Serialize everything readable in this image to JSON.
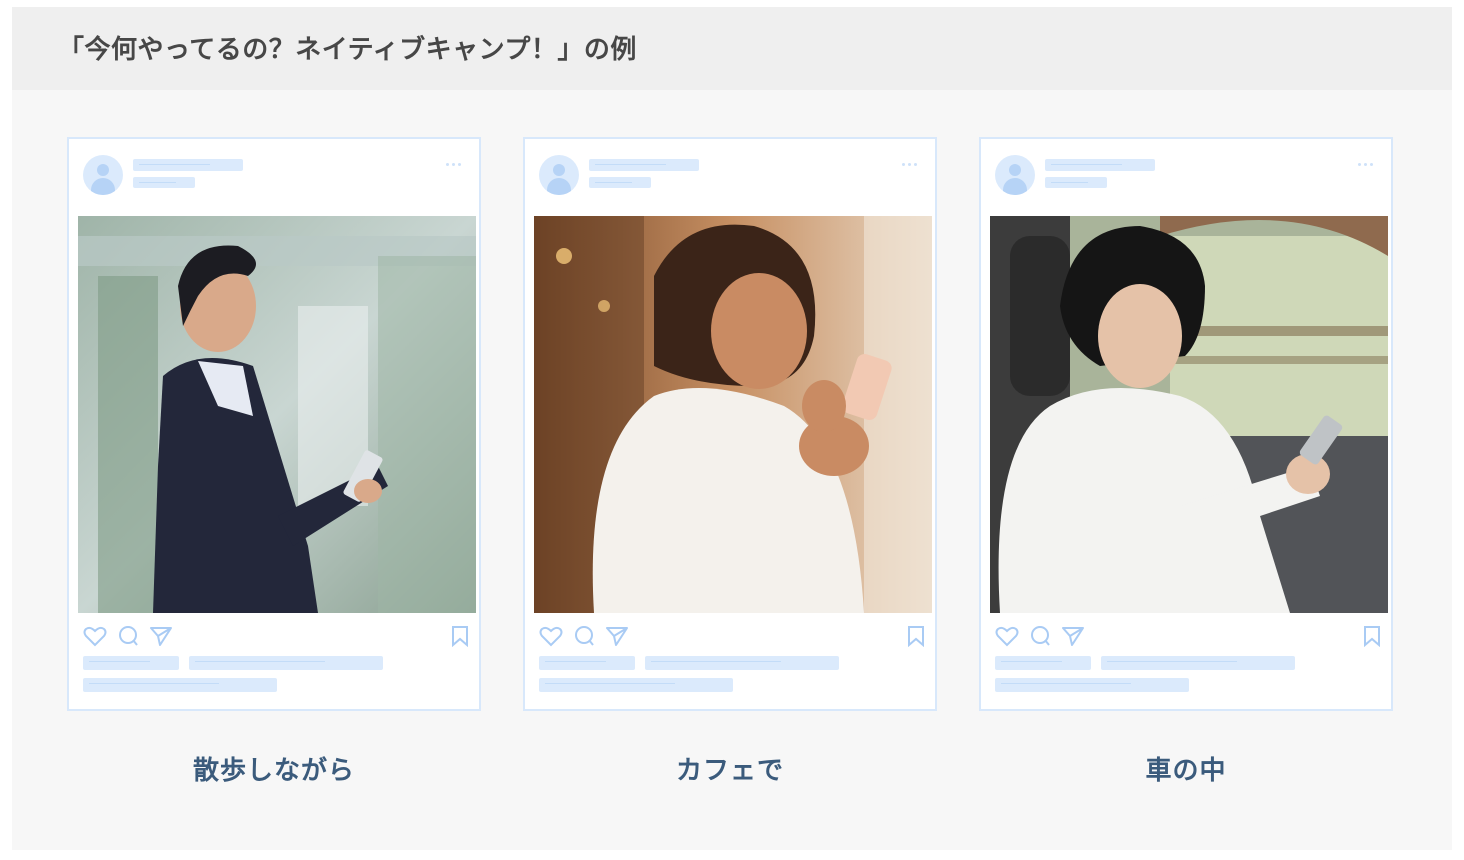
{
  "header": {
    "title": "「今何やってるの？ネイティブキャンプ！」の例"
  },
  "cards": [
    {
      "caption": "散歩しながら",
      "photo_icon": "man-with-tablet-photo"
    },
    {
      "caption": "カフェで",
      "photo_icon": "woman-with-phone-cafe-photo"
    },
    {
      "caption": "車の中",
      "photo_icon": "woman-with-phone-car-photo"
    }
  ],
  "colors": {
    "accent_light": "#dbeafc",
    "card_border": "#d8e8fb",
    "caption": "#3b5b7c",
    "title": "#474747"
  }
}
